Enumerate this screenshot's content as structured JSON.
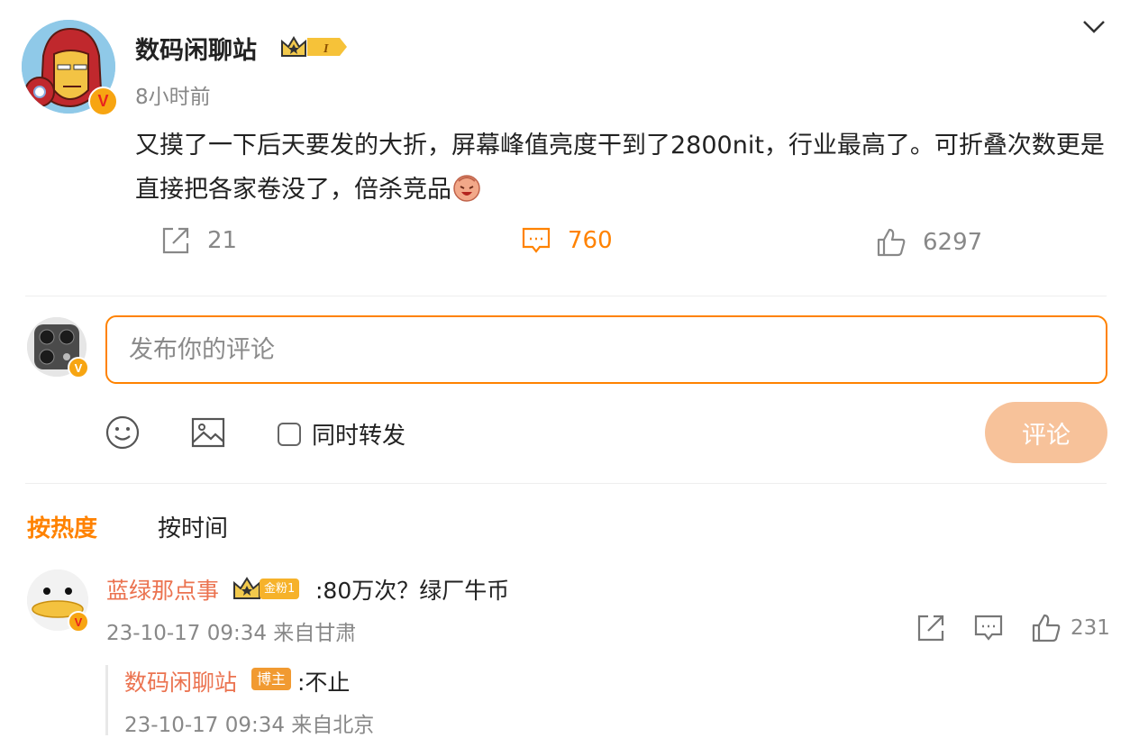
{
  "post": {
    "author": "数码闲聊站",
    "level_badge": "I",
    "time": "8小时前",
    "text": "又摸了一下后天要发的大折，屏幕峰值亮度干到了2800nit，行业最高了。可折叠次数更是直接把各家卷没了，倍杀竞品",
    "verified_badge": "V",
    "reposts": "21",
    "comments": "760",
    "likes": "6297"
  },
  "composer": {
    "placeholder": "发布你的评论",
    "also_repost_label": "同时转发",
    "submit_label": "评论"
  },
  "sort_tabs": {
    "hot": "按热度",
    "time": "按时间"
  },
  "comments": [
    {
      "user": "蓝绿那点事",
      "fan_badge": "金粉1",
      "text": ":80万次？绿厂牛币",
      "meta": "23-10-17 09:34 来自甘肃",
      "likes": "231",
      "reply": {
        "user": "数码闲聊站",
        "tag": "博主",
        "text": ":不止",
        "meta": "23-10-17 09:34 来自北京"
      }
    }
  ],
  "colors": {
    "accent": "#ff8200",
    "username": "#eb7350",
    "submit_disabled": "#f7c29a"
  },
  "icons": [
    "chevron-down-icon",
    "repost-icon",
    "comment-icon",
    "like-icon",
    "emoji-icon",
    "image-icon",
    "checkbox-icon",
    "crown-icon",
    "laugh-emoji-icon"
  ]
}
